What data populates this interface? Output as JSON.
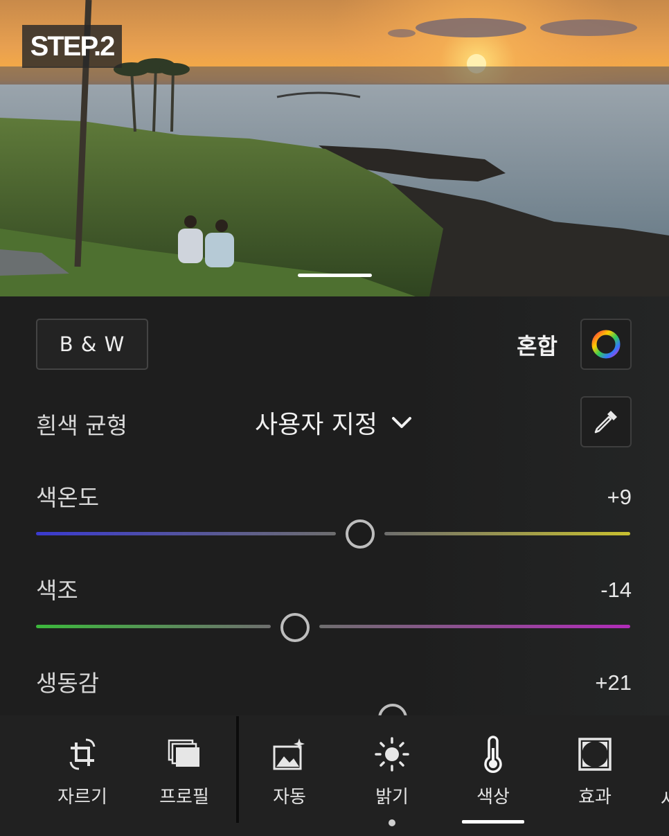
{
  "photo": {
    "step_badge": "STEP.2"
  },
  "panel": {
    "bw_button": "B & W",
    "mix_label": "혼합",
    "white_balance": {
      "label": "흰색 균형",
      "selected": "사용자 지정"
    },
    "sliders": [
      {
        "label": "색온도",
        "value": "+9",
        "position": 0.546
      },
      {
        "label": "색조",
        "value": "-14",
        "position": 0.436
      },
      {
        "label": "생동감",
        "value": "+21"
      }
    ]
  },
  "toolbar": {
    "tools": [
      {
        "label": "자르기",
        "icon": "crop-rotate-icon"
      },
      {
        "label": "프로필",
        "icon": "profile-icon"
      },
      {
        "label": "자동",
        "icon": "auto-enhance-icon"
      },
      {
        "label": "밝기",
        "icon": "sun-icon"
      },
      {
        "label": "색상",
        "icon": "thermometer-icon",
        "active": true
      },
      {
        "label": "효과",
        "icon": "vignette-icon"
      }
    ],
    "partial_label": "사"
  },
  "colors": {
    "temp_left": "#3a3ad0",
    "temp_right": "#c8c030",
    "tint_left": "#3cb83c",
    "tint_right": "#b02cb8"
  }
}
